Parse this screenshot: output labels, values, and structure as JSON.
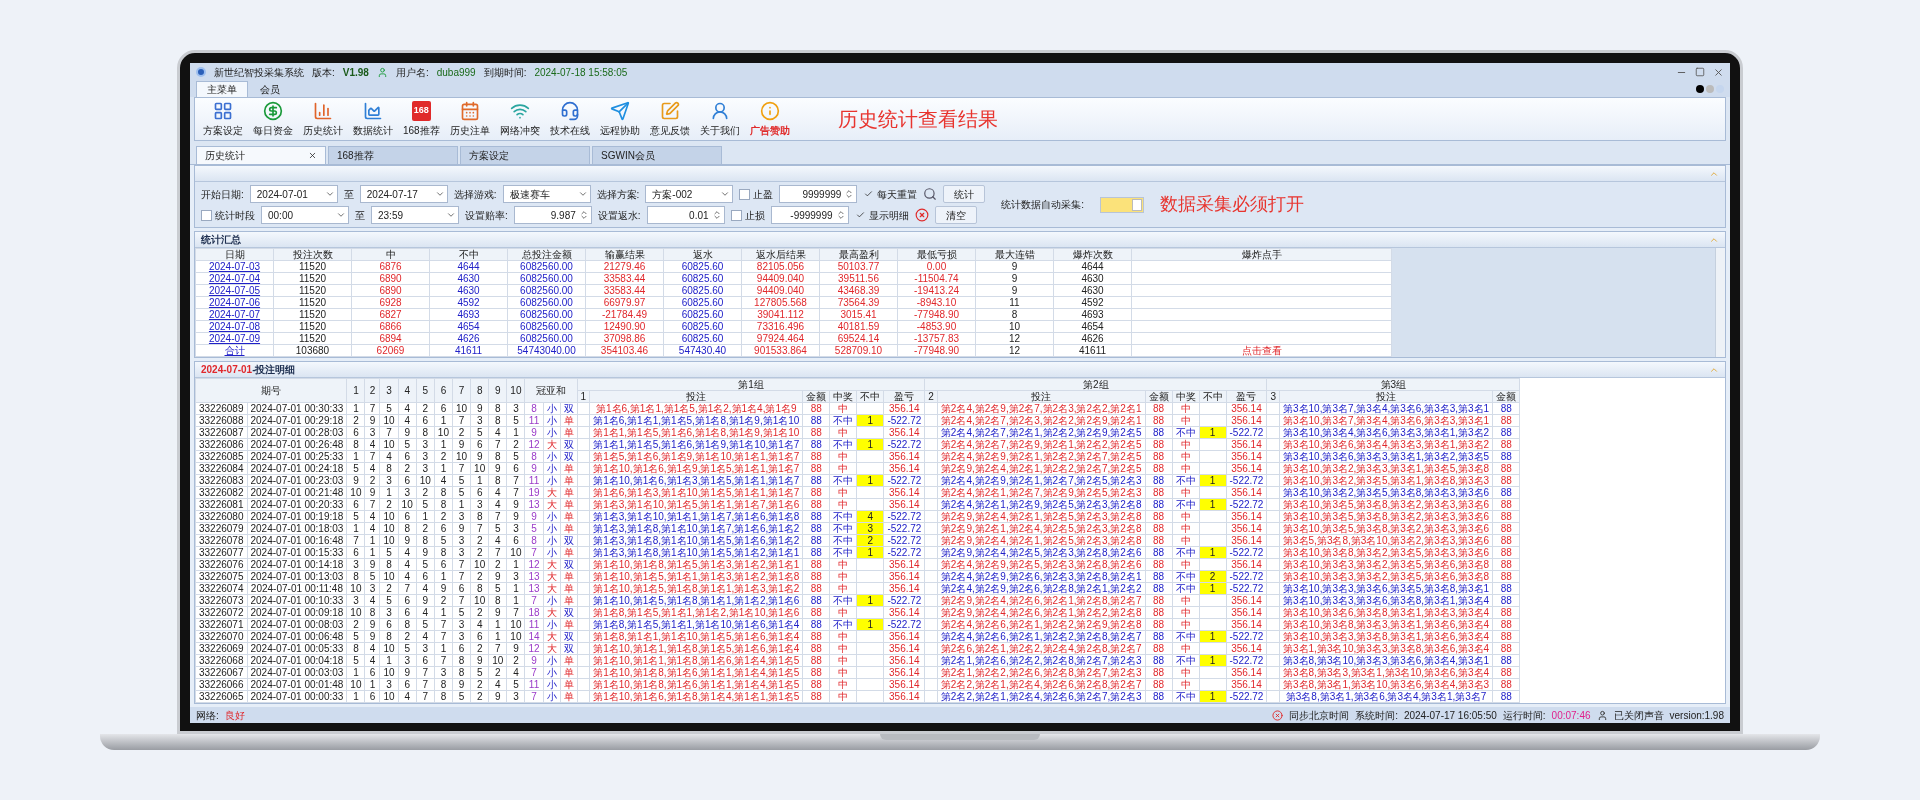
{
  "window": {
    "title": "新世纪智投采集系统",
    "version_label": "版本:",
    "version": "V1.98",
    "user_label": "用户名:",
    "user": "duba999",
    "expiry_label": "到期时间:",
    "expiry": "2024-07-18 15:58:05"
  },
  "ribbon_tabs": [
    {
      "label": "主菜单",
      "selected": true
    },
    {
      "label": "会员",
      "selected": false
    }
  ],
  "toolbar": [
    {
      "label": "方案设定",
      "kind": "normal"
    },
    {
      "label": "每日资金",
      "kind": "normal"
    },
    {
      "label": "历史统计",
      "kind": "normal"
    },
    {
      "label": "数据统计",
      "kind": "normal"
    },
    {
      "label": "168推荐",
      "kind": "normal",
      "badge": "168"
    },
    {
      "label": "历史注单",
      "kind": "normal"
    },
    {
      "label": "网络冲突",
      "kind": "normal"
    },
    {
      "label": "技术在线",
      "kind": "normal"
    },
    {
      "label": "远程协助",
      "kind": "normal"
    },
    {
      "label": "意见反馈",
      "kind": "normal"
    },
    {
      "label": "关于我们",
      "kind": "normal"
    },
    {
      "label": "广告赞助",
      "kind": "promo"
    }
  ],
  "banner": "历史统计查看结果",
  "doc_tabs": [
    {
      "label": "历史统计",
      "selected": true
    },
    {
      "label": "168推荐",
      "selected": false
    },
    {
      "label": "方案设定",
      "selected": false
    },
    {
      "label": "SGWIN会员",
      "selected": false
    }
  ],
  "filters": [
    [
      {
        "kind": "label",
        "text": "开始日期:"
      },
      {
        "kind": "select",
        "value": "2024-07-01"
      },
      {
        "kind": "label",
        "text": "至"
      },
      {
        "kind": "select",
        "value": "2024-07-17"
      },
      {
        "kind": "label",
        "text": "选择游戏:"
      },
      {
        "kind": "select",
        "value": "极速赛车"
      },
      {
        "kind": "label",
        "text": "选择方案:"
      },
      {
        "kind": "select",
        "value": "方案-002"
      },
      {
        "kind": "checkbox",
        "label": "止盈",
        "checked": false
      },
      {
        "kind": "spin",
        "value": "9999999"
      },
      {
        "kind": "checkbox",
        "label": "每天重置",
        "checked": true
      },
      {
        "kind": "search",
        "label": "统计"
      }
    ],
    [
      {
        "kind": "checkbox",
        "label": "统计时段",
        "checked": false
      },
      {
        "kind": "select",
        "value": "00:00"
      },
      {
        "kind": "label",
        "text": "至"
      },
      {
        "kind": "select",
        "value": "23:59"
      },
      {
        "kind": "label",
        "text": "设置赔率:"
      },
      {
        "kind": "spin",
        "value": "9.987"
      },
      {
        "kind": "label",
        "text": "设置返水:"
      },
      {
        "kind": "spin",
        "value": "0.01"
      },
      {
        "kind": "checkbox",
        "label": "止损",
        "checked": false
      },
      {
        "kind": "spin",
        "value": "-9999999"
      },
      {
        "kind": "checkbox",
        "label": "显示明细",
        "checked": true
      },
      {
        "kind": "clear",
        "label": "清空"
      }
    ]
  ],
  "auto_collect": {
    "label": "统计数据自动采集:",
    "on": true
  },
  "collect_note": "数据采集必须打开",
  "summary": {
    "title": "统计汇总",
    "columns": [
      "日期",
      "投注次数",
      "中",
      "不中",
      "总投注金额",
      "输赢结果",
      "返水",
      "返水后结果",
      "最高盈利",
      "最低亏损",
      "最大连错",
      "爆炸次数",
      "爆炸点手"
    ],
    "rows": [
      {
        "cells": [
          "2024-07-03",
          "11520",
          "6876",
          "4644",
          "6082560.00",
          "21279.46",
          "60825.60",
          "82105.056",
          "50103.77",
          "0.00",
          "9",
          "4644"
        ]
      },
      {
        "cells": [
          "2024-07-04",
          "11520",
          "6890",
          "4630",
          "6082560.00",
          "33583.44",
          "60825.60",
          "94409.040",
          "39511.56",
          "-11504.74",
          "9",
          "4630"
        ]
      },
      {
        "cells": [
          "2024-07-05",
          "11520",
          "6890",
          "4630",
          "6082560.00",
          "33583.44",
          "60825.60",
          "94409.040",
          "43468.39",
          "-19413.24",
          "9",
          "4630"
        ]
      },
      {
        "cells": [
          "2024-07-06",
          "11520",
          "6928",
          "4592",
          "6082560.00",
          "66979.97",
          "60825.60",
          "127805.568",
          "73564.39",
          "-8943.10",
          "11",
          "4592"
        ]
      },
      {
        "cells": [
          "2024-07-07",
          "11520",
          "6827",
          "4693",
          "6082560.00",
          "-21784.49",
          "60825.60",
          "39041.112",
          "3015.41",
          "-77948.90",
          "8",
          "4693"
        ]
      },
      {
        "cells": [
          "2024-07-08",
          "11520",
          "6866",
          "4654",
          "6082560.00",
          "12490.90",
          "60825.60",
          "73316.496",
          "40181.59",
          "-4853.90",
          "10",
          "4654"
        ]
      },
      {
        "cells": [
          "2024-07-09",
          "11520",
          "6894",
          "4626",
          "6082560.00",
          "37098.86",
          "60825.60",
          "97924.464",
          "69524.14",
          "-13757.83",
          "12",
          "4626"
        ]
      },
      {
        "cells": [
          "合计",
          "103680",
          "62069",
          "41611",
          "54743040.00",
          "354103.46",
          "547430.40",
          "901533.864",
          "528709.10",
          "-77948.90",
          "12",
          "41611",
          "点击查看"
        ]
      }
    ]
  },
  "detail": {
    "date": "2024-07-01",
    "title": "-投注明细",
    "period_header": "期号",
    "number_headers": [
      "1",
      "2",
      "3",
      "4",
      "5",
      "6",
      "7",
      "8",
      "9",
      "10"
    ],
    "sum_header": "冠亚和",
    "groups": [
      {
        "title": "第1组",
        "index": "1",
        "columns": [
          "投注",
          "金额",
          "中奖",
          "不中",
          "盈亏"
        ]
      },
      {
        "title": "第2组",
        "index": "2",
        "columns": [
          "投注",
          "金额",
          "中奖",
          "不中",
          "盈亏"
        ]
      },
      {
        "title": "第3组",
        "index": "3",
        "columns": [
          "投注",
          "金额"
        ]
      }
    ],
    "rows": [
      {
        "period": "33226089",
        "time": "2024-07-01 00:30:33",
        "nums": [
          "1",
          "7",
          "5",
          "4",
          "2",
          "6",
          "10",
          "9",
          "8",
          "3"
        ],
        "sum": "8",
        "size": "小",
        "big": false,
        "parity": "双",
        "odd": false,
        "groups": [
          {
            "bet": "第1名6,第1名1,第1名5,第1名2,第1名4,第1名9",
            "amount": "88",
            "hit": true,
            "result": "中",
            "profit": "356.14"
          },
          {
            "bet": "第2名4,第2名9,第2名7,第2名3,第2名2,第2名1",
            "amount": "88",
            "hit": true,
            "result": "中",
            "profit": "356.14"
          },
          {
            "bet": "第3名10,第3名7,第3名4,第3名6,第3名3,第3名1",
            "amount": "88",
            "hit": false
          }
        ]
      },
      {
        "period": "33226088",
        "time": "2024-07-01 00:29:18",
        "nums": [
          "2",
          "9",
          "10",
          "4",
          "6",
          "1",
          "7",
          "3",
          "8",
          "5"
        ],
        "sum": "11",
        "size": "小",
        "big": false,
        "parity": "单",
        "odd": true,
        "groups": [
          {
            "bet": "第1名6,第1名1,第1名5,第1名8,第1名9,第1名10",
            "amount": "88",
            "hit": false,
            "result": "不中",
            "streak": "1",
            "profit": "-522.72"
          },
          {
            "bet": "第2名4,第2名7,第2名3,第2名2,第2名9,第2名1",
            "amount": "88",
            "hit": true,
            "result": "中",
            "profit": "356.14"
          },
          {
            "bet": "第3名10,第3名7,第3名4,第3名6,第3名3,第3名1",
            "amount": "88",
            "hit": true
          }
        ]
      },
      {
        "period": "33226087",
        "time": "2024-07-01 00:28:03",
        "nums": [
          "6",
          "3",
          "7",
          "9",
          "8",
          "10",
          "2",
          "5",
          "4",
          "1"
        ],
        "sum": "9",
        "size": "小",
        "big": false,
        "parity": "单",
        "odd": true,
        "groups": [
          {
            "bet": "第1名1,第1名5,第1名6,第1名8,第1名9,第1名10",
            "amount": "88",
            "hit": true,
            "result": "中",
            "profit": "356.14"
          },
          {
            "bet": "第2名4,第2名7,第2名1,第2名2,第2名9,第2名5",
            "amount": "88",
            "hit": false,
            "result": "不中",
            "streak": "1",
            "profit": "-522.72"
          },
          {
            "bet": "第3名10,第3名4,第3名6,第3名3,第3名1,第3名2",
            "amount": "88",
            "hit": false
          }
        ]
      },
      {
        "period": "33226086",
        "time": "2024-07-01 00:26:48",
        "nums": [
          "8",
          "4",
          "10",
          "5",
          "3",
          "1",
          "9",
          "6",
          "7",
          "2"
        ],
        "sum": "12",
        "size": "大",
        "big": true,
        "parity": "双",
        "odd": false,
        "groups": [
          {
            "bet": "第1名1,第1名5,第1名6,第1名9,第1名10,第1名7",
            "amount": "88",
            "hit": false,
            "result": "不中",
            "streak": "1",
            "profit": "-522.72"
          },
          {
            "bet": "第2名4,第2名7,第2名9,第2名1,第2名2,第2名5",
            "amount": "88",
            "hit": true,
            "result": "中",
            "profit": "356.14"
          },
          {
            "bet": "第3名10,第3名6,第3名4,第3名3,第3名1,第3名2",
            "amount": "88",
            "hit": true
          }
        ]
      },
      {
        "period": "33226085",
        "time": "2024-07-01 00:25:33",
        "nums": [
          "1",
          "7",
          "4",
          "6",
          "3",
          "2",
          "10",
          "9",
          "8",
          "5"
        ],
        "sum": "8",
        "size": "小",
        "big": false,
        "parity": "双",
        "odd": false,
        "groups": [
          {
            "bet": "第1名5,第1名6,第1名9,第1名10,第1名1,第1名7",
            "amount": "88",
            "hit": true,
            "result": "中",
            "profit": "356.14"
          },
          {
            "bet": "第2名4,第2名9,第2名1,第2名2,第2名7,第2名5",
            "amount": "88",
            "hit": true,
            "result": "中",
            "profit": "356.14"
          },
          {
            "bet": "第3名10,第3名6,第3名3,第3名1,第3名2,第3名5",
            "amount": "88",
            "hit": false
          }
        ]
      },
      {
        "period": "33226084",
        "time": "2024-07-01 00:24:18",
        "nums": [
          "5",
          "4",
          "8",
          "2",
          "3",
          "1",
          "7",
          "10",
          "9",
          "6"
        ],
        "sum": "9",
        "size": "小",
        "big": false,
        "parity": "单",
        "odd": true,
        "groups": [
          {
            "bet": "第1名10,第1名6,第1名9,第1名5,第1名1,第1名7",
            "amount": "88",
            "hit": true,
            "result": "中",
            "profit": "356.14"
          },
          {
            "bet": "第2名9,第2名4,第2名1,第2名2,第2名7,第2名5",
            "amount": "88",
            "hit": true,
            "result": "中",
            "profit": "356.14"
          },
          {
            "bet": "第3名10,第3名2,第3名3,第3名1,第3名5,第3名8",
            "amount": "88",
            "hit": true
          }
        ]
      },
      {
        "period": "33226083",
        "time": "2024-07-01 00:23:03",
        "nums": [
          "9",
          "2",
          "3",
          "6",
          "10",
          "4",
          "5",
          "1",
          "8",
          "7"
        ],
        "sum": "11",
        "size": "小",
        "big": false,
        "parity": "单",
        "odd": true,
        "groups": [
          {
            "bet": "第1名10,第1名6,第1名3,第1名5,第1名1,第1名7",
            "amount": "88",
            "hit": false,
            "result": "不中",
            "streak": "1",
            "profit": "-522.72"
          },
          {
            "bet": "第2名4,第2名9,第2名1,第2名7,第2名5,第2名3",
            "amount": "88",
            "hit": false,
            "result": "不中",
            "streak": "1",
            "profit": "-522.72"
          },
          {
            "bet": "第3名10,第3名2,第3名5,第3名1,第3名8,第3名3",
            "amount": "88",
            "hit": true
          }
        ]
      },
      {
        "period": "33226082",
        "time": "2024-07-01 00:21:48",
        "nums": [
          "10",
          "9",
          "1",
          "3",
          "2",
          "8",
          "5",
          "6",
          "4",
          "7"
        ],
        "sum": "19",
        "size": "大",
        "big": true,
        "parity": "单",
        "odd": true,
        "groups": [
          {
            "bet": "第1名6,第1名3,第1名10,第1名5,第1名1,第1名7",
            "amount": "88",
            "hit": true,
            "result": "中",
            "profit": "356.14"
          },
          {
            "bet": "第2名4,第2名1,第2名7,第2名9,第2名5,第2名3",
            "amount": "88",
            "hit": true,
            "result": "中",
            "profit": "356.14"
          },
          {
            "bet": "第3名10,第3名2,第3名5,第3名8,第3名3,第3名6",
            "amount": "88",
            "hit": false
          }
        ]
      },
      {
        "period": "33226081",
        "time": "2024-07-01 00:20:33",
        "nums": [
          "6",
          "7",
          "2",
          "10",
          "5",
          "8",
          "1",
          "3",
          "4",
          "9"
        ],
        "sum": "13",
        "size": "大",
        "big": true,
        "parity": "单",
        "odd": true,
        "groups": [
          {
            "bet": "第1名3,第1名10,第1名5,第1名1,第1名7,第1名6",
            "amount": "88",
            "hit": true,
            "result": "中",
            "profit": "356.14"
          },
          {
            "bet": "第2名4,第2名1,第2名9,第2名5,第2名3,第2名8",
            "amount": "88",
            "hit": false,
            "result": "不中",
            "streak": "1",
            "profit": "-522.72"
          },
          {
            "bet": "第3名10,第3名5,第3名8,第3名2,第3名3,第3名6",
            "amount": "88",
            "hit": true
          }
        ]
      },
      {
        "period": "33226080",
        "time": "2024-07-01 00:19:18",
        "nums": [
          "5",
          "4",
          "10",
          "6",
          "1",
          "2",
          "3",
          "8",
          "7",
          "9"
        ],
        "sum": "9",
        "size": "小",
        "big": false,
        "parity": "单",
        "odd": true,
        "groups": [
          {
            "bet": "第1名3,第1名10,第1名1,第1名7,第1名6,第1名8",
            "amount": "88",
            "hit": false,
            "result": "不中",
            "streak": "4",
            "profit": "-522.72"
          },
          {
            "bet": "第2名9,第2名4,第2名1,第2名5,第2名3,第2名8",
            "amount": "88",
            "hit": true,
            "result": "中",
            "profit": "356.14"
          },
          {
            "bet": "第3名10,第3名5,第3名8,第3名2,第3名3,第3名6",
            "amount": "88",
            "hit": true
          }
        ]
      },
      {
        "period": "33226079",
        "time": "2024-07-01 00:18:03",
        "nums": [
          "1",
          "4",
          "10",
          "8",
          "2",
          "6",
          "9",
          "7",
          "5",
          "3"
        ],
        "sum": "5",
        "size": "小",
        "big": false,
        "parity": "单",
        "odd": true,
        "groups": [
          {
            "bet": "第1名3,第1名8,第1名10,第1名7,第1名6,第1名2",
            "amount": "88",
            "hit": false,
            "result": "不中",
            "streak": "3",
            "profit": "-522.72"
          },
          {
            "bet": "第2名9,第2名1,第2名4,第2名5,第2名3,第2名8",
            "amount": "88",
            "hit": true,
            "result": "中",
            "profit": "356.14"
          },
          {
            "bet": "第3名10,第3名5,第3名8,第3名2,第3名3,第3名6",
            "amount": "88",
            "hit": true
          }
        ]
      },
      {
        "period": "33226078",
        "time": "2024-07-01 00:16:48",
        "nums": [
          "7",
          "1",
          "10",
          "9",
          "8",
          "5",
          "3",
          "2",
          "4",
          "6"
        ],
        "sum": "8",
        "size": "小",
        "big": false,
        "parity": "双",
        "odd": false,
        "groups": [
          {
            "bet": "第1名3,第1名8,第1名10,第1名5,第1名6,第1名2",
            "amount": "88",
            "hit": false,
            "result": "不中",
            "streak": "2",
            "profit": "-522.72"
          },
          {
            "bet": "第2名9,第2名4,第2名1,第2名5,第2名3,第2名8",
            "amount": "88",
            "hit": true,
            "result": "中",
            "profit": "356.14"
          },
          {
            "bet": "第3名5,第3名8,第3名10,第3名2,第3名3,第3名6",
            "amount": "88",
            "hit": true
          }
        ]
      },
      {
        "period": "33226077",
        "time": "2024-07-01 00:15:33",
        "nums": [
          "6",
          "1",
          "5",
          "4",
          "9",
          "8",
          "3",
          "2",
          "7",
          "10"
        ],
        "sum": "7",
        "size": "小",
        "big": false,
        "parity": "单",
        "odd": true,
        "groups": [
          {
            "bet": "第1名3,第1名8,第1名10,第1名5,第1名2,第1名1",
            "amount": "88",
            "hit": false,
            "result": "不中",
            "streak": "1",
            "profit": "-522.72"
          },
          {
            "bet": "第2名9,第2名4,第2名5,第2名3,第2名8,第2名6",
            "amount": "88",
            "hit": false,
            "result": "不中",
            "streak": "1",
            "profit": "-522.72"
          },
          {
            "bet": "第3名10,第3名8,第3名2,第3名5,第3名3,第3名6",
            "amount": "88",
            "hit": true
          }
        ]
      },
      {
        "period": "33226076",
        "time": "2024-07-01 00:14:18",
        "nums": [
          "3",
          "9",
          "8",
          "4",
          "5",
          "6",
          "7",
          "10",
          "2",
          "1"
        ],
        "sum": "12",
        "size": "大",
        "big": true,
        "parity": "双",
        "odd": false,
        "groups": [
          {
            "bet": "第1名10,第1名8,第1名5,第1名3,第1名2,第1名1",
            "amount": "88",
            "hit": true,
            "result": "中",
            "profit": "356.14"
          },
          {
            "bet": "第2名4,第2名9,第2名5,第2名3,第2名8,第2名6",
            "amount": "88",
            "hit": true,
            "result": "中",
            "profit": "356.14"
          },
          {
            "bet": "第3名10,第3名3,第3名2,第3名5,第3名6,第3名8",
            "amount": "88",
            "hit": true
          }
        ]
      },
      {
        "period": "33226075",
        "time": "2024-07-01 00:13:03",
        "nums": [
          "8",
          "5",
          "10",
          "4",
          "6",
          "1",
          "7",
          "2",
          "9",
          "3"
        ],
        "sum": "13",
        "size": "大",
        "big": true,
        "parity": "单",
        "odd": true,
        "groups": [
          {
            "bet": "第1名10,第1名5,第1名1,第1名3,第1名2,第1名8",
            "amount": "88",
            "hit": true,
            "result": "中",
            "profit": "356.14"
          },
          {
            "bet": "第2名4,第2名9,第2名6,第2名3,第2名8,第2名1",
            "amount": "88",
            "hit": false,
            "result": "不中",
            "streak": "2",
            "profit": "-522.72"
          },
          {
            "bet": "第3名10,第3名3,第3名2,第3名5,第3名6,第3名8",
            "amount": "88",
            "hit": true
          }
        ]
      },
      {
        "period": "33226074",
        "time": "2024-07-01 00:11:48",
        "nums": [
          "10",
          "3",
          "2",
          "7",
          "4",
          "9",
          "6",
          "8",
          "5",
          "1"
        ],
        "sum": "13",
        "size": "大",
        "big": true,
        "parity": "单",
        "odd": true,
        "groups": [
          {
            "bet": "第1名10,第1名5,第1名8,第1名1,第1名3,第1名2",
            "amount": "88",
            "hit": true,
            "result": "中",
            "profit": "356.14"
          },
          {
            "bet": "第2名4,第2名9,第2名6,第2名8,第2名1,第2名2",
            "amount": "88",
            "hit": false,
            "result": "不中",
            "streak": "1",
            "profit": "-522.72"
          },
          {
            "bet": "第3名10,第3名3,第3名6,第3名5,第3名8,第3名1",
            "amount": "88",
            "hit": false
          }
        ]
      },
      {
        "period": "33226073",
        "time": "2024-07-01 00:10:33",
        "nums": [
          "3",
          "4",
          "5",
          "6",
          "9",
          "2",
          "7",
          "10",
          "8",
          "1"
        ],
        "sum": "7",
        "size": "小",
        "big": false,
        "parity": "单",
        "odd": true,
        "groups": [
          {
            "bet": "第1名10,第1名5,第1名8,第1名1,第1名2,第1名6",
            "amount": "88",
            "hit": false,
            "result": "不中",
            "streak": "1",
            "profit": "-522.72"
          },
          {
            "bet": "第2名9,第2名4,第2名6,第2名1,第2名8,第2名7",
            "amount": "88",
            "hit": true,
            "result": "中",
            "profit": "356.14"
          },
          {
            "bet": "第3名10,第3名3,第3名6,第3名8,第3名1,第3名4",
            "amount": "88",
            "hit": false
          }
        ]
      },
      {
        "period": "33226072",
        "time": "2024-07-01 00:09:18",
        "nums": [
          "10",
          "8",
          "3",
          "6",
          "4",
          "1",
          "5",
          "2",
          "9",
          "7"
        ],
        "sum": "18",
        "size": "大",
        "big": true,
        "parity": "双",
        "odd": false,
        "groups": [
          {
            "bet": "第1名8,第1名5,第1名1,第1名2,第1名10,第1名6",
            "amount": "88",
            "hit": true,
            "result": "中",
            "profit": "356.14"
          },
          {
            "bet": "第2名9,第2名4,第2名6,第2名1,第2名2,第2名8",
            "amount": "88",
            "hit": true,
            "result": "中",
            "profit": "356.14"
          },
          {
            "bet": "第3名10,第3名6,第3名8,第3名1,第3名3,第3名4",
            "amount": "88",
            "hit": true
          }
        ]
      },
      {
        "period": "33226071",
        "time": "2024-07-01 00:08:03",
        "nums": [
          "2",
          "9",
          "6",
          "8",
          "5",
          "7",
          "3",
          "4",
          "1",
          "10"
        ],
        "sum": "11",
        "size": "小",
        "big": false,
        "parity": "单",
        "odd": true,
        "groups": [
          {
            "bet": "第1名8,第1名5,第1名1,第1名10,第1名6,第1名4",
            "amount": "88",
            "hit": false,
            "result": "不中",
            "streak": "1",
            "profit": "-522.72"
          },
          {
            "bet": "第2名4,第2名6,第2名1,第2名2,第2名9,第2名8",
            "amount": "88",
            "hit": true,
            "result": "中",
            "profit": "356.14"
          },
          {
            "bet": "第3名10,第3名8,第3名3,第3名1,第3名6,第3名4",
            "amount": "88",
            "hit": true
          }
        ]
      },
      {
        "period": "33226070",
        "time": "2024-07-01 00:06:48",
        "nums": [
          "5",
          "9",
          "8",
          "2",
          "4",
          "7",
          "3",
          "6",
          "1",
          "10"
        ],
        "sum": "14",
        "size": "大",
        "big": true,
        "parity": "双",
        "odd": false,
        "groups": [
          {
            "bet": "第1名8,第1名1,第1名10,第1名5,第1名6,第1名4",
            "amount": "88",
            "hit": true,
            "result": "中",
            "profit": "356.14"
          },
          {
            "bet": "第2名4,第2名6,第2名1,第2名2,第2名8,第2名7",
            "amount": "88",
            "hit": false,
            "result": "不中",
            "streak": "1",
            "profit": "-522.72"
          },
          {
            "bet": "第3名10,第3名3,第3名8,第3名1,第3名6,第3名4",
            "amount": "88",
            "hit": true
          }
        ]
      },
      {
        "period": "33226069",
        "time": "2024-07-01 00:05:33",
        "nums": [
          "8",
          "4",
          "10",
          "5",
          "3",
          "1",
          "6",
          "2",
          "7",
          "9"
        ],
        "sum": "12",
        "size": "大",
        "big": true,
        "parity": "双",
        "odd": false,
        "groups": [
          {
            "bet": "第1名10,第1名1,第1名8,第1名5,第1名6,第1名4",
            "amount": "88",
            "hit": true,
            "result": "中",
            "profit": "356.14"
          },
          {
            "bet": "第2名6,第2名1,第2名2,第2名4,第2名8,第2名7",
            "amount": "88",
            "hit": true,
            "result": "中",
            "profit": "356.14"
          },
          {
            "bet": "第3名1,第3名10,第3名3,第3名8,第3名6,第3名4",
            "amount": "88",
            "hit": true
          }
        ]
      },
      {
        "period": "33226068",
        "time": "2024-07-01 00:04:18",
        "nums": [
          "5",
          "4",
          "1",
          "3",
          "6",
          "7",
          "8",
          "9",
          "10",
          "2"
        ],
        "sum": "9",
        "size": "小",
        "big": false,
        "parity": "单",
        "odd": true,
        "groups": [
          {
            "bet": "第1名10,第1名1,第1名8,第1名6,第1名4,第1名5",
            "amount": "88",
            "hit": true,
            "result": "中",
            "profit": "356.14"
          },
          {
            "bet": "第2名1,第2名6,第2名2,第2名8,第2名7,第2名3",
            "amount": "88",
            "hit": false,
            "result": "不中",
            "streak": "1",
            "profit": "-522.72"
          },
          {
            "bet": "第3名8,第3名10,第3名3,第3名6,第3名4,第3名1",
            "amount": "88",
            "hit": false
          }
        ]
      },
      {
        "period": "33226067",
        "time": "2024-07-01 00:03:03",
        "nums": [
          "1",
          "6",
          "10",
          "9",
          "7",
          "3",
          "8",
          "5",
          "2",
          "4"
        ],
        "sum": "7",
        "size": "小",
        "big": false,
        "parity": "单",
        "odd": true,
        "groups": [
          {
            "bet": "第1名10,第1名8,第1名6,第1名1,第1名4,第1名5",
            "amount": "88",
            "hit": true,
            "result": "中",
            "profit": "356.14"
          },
          {
            "bet": "第2名1,第2名2,第2名6,第2名8,第2名7,第2名3",
            "amount": "88",
            "hit": true,
            "result": "中",
            "profit": "356.14"
          },
          {
            "bet": "第3名8,第3名3,第3名1,第3名10,第3名6,第3名4",
            "amount": "88",
            "hit": true
          }
        ]
      },
      {
        "period": "33226066",
        "time": "2024-07-01 00:01:48",
        "nums": [
          "10",
          "1",
          "3",
          "6",
          "7",
          "8",
          "9",
          "2",
          "4",
          "5"
        ],
        "sum": "11",
        "size": "小",
        "big": false,
        "parity": "单",
        "odd": true,
        "groups": [
          {
            "bet": "第1名10,第1名8,第1名6,第1名1,第1名4,第1名5",
            "amount": "88",
            "hit": true,
            "result": "中",
            "profit": "356.14"
          },
          {
            "bet": "第2名2,第2名1,第2名4,第2名6,第2名8,第2名7",
            "amount": "88",
            "hit": true,
            "result": "中",
            "profit": "356.14"
          },
          {
            "bet": "第3名8,第3名1,第3名10,第3名6,第3名4,第3名3",
            "amount": "88",
            "hit": true
          }
        ]
      },
      {
        "period": "33226065",
        "time": "2024-07-01 00:00:33",
        "nums": [
          "1",
          "6",
          "10",
          "4",
          "7",
          "8",
          "5",
          "2",
          "9",
          "3"
        ],
        "sum": "7",
        "size": "小",
        "big": false,
        "parity": "单",
        "odd": true,
        "groups": [
          {
            "bet": "第1名10,第1名6,第1名8,第1名4,第1名1,第1名5",
            "amount": "88",
            "hit": true,
            "result": "中",
            "profit": "356.14"
          },
          {
            "bet": "第2名2,第2名1,第2名4,第2名6,第2名7,第2名3",
            "amount": "88",
            "hit": false,
            "result": "不中",
            "streak": "1",
            "profit": "-522.72"
          },
          {
            "bet": "第3名8,第3名1,第3名6,第3名4,第3名1,第3名7",
            "amount": "88",
            "hit": false
          }
        ]
      }
    ]
  },
  "status_bar": {
    "network_label": "网络:",
    "network": "良好",
    "sync": "同步北京时间",
    "time_label": "系统时间:",
    "time": "2024-07-17 16:05:50",
    "run_label": "运行时间:",
    "run": "00:07:46",
    "sound": "已关闭声音",
    "version": "version:1.98"
  }
}
